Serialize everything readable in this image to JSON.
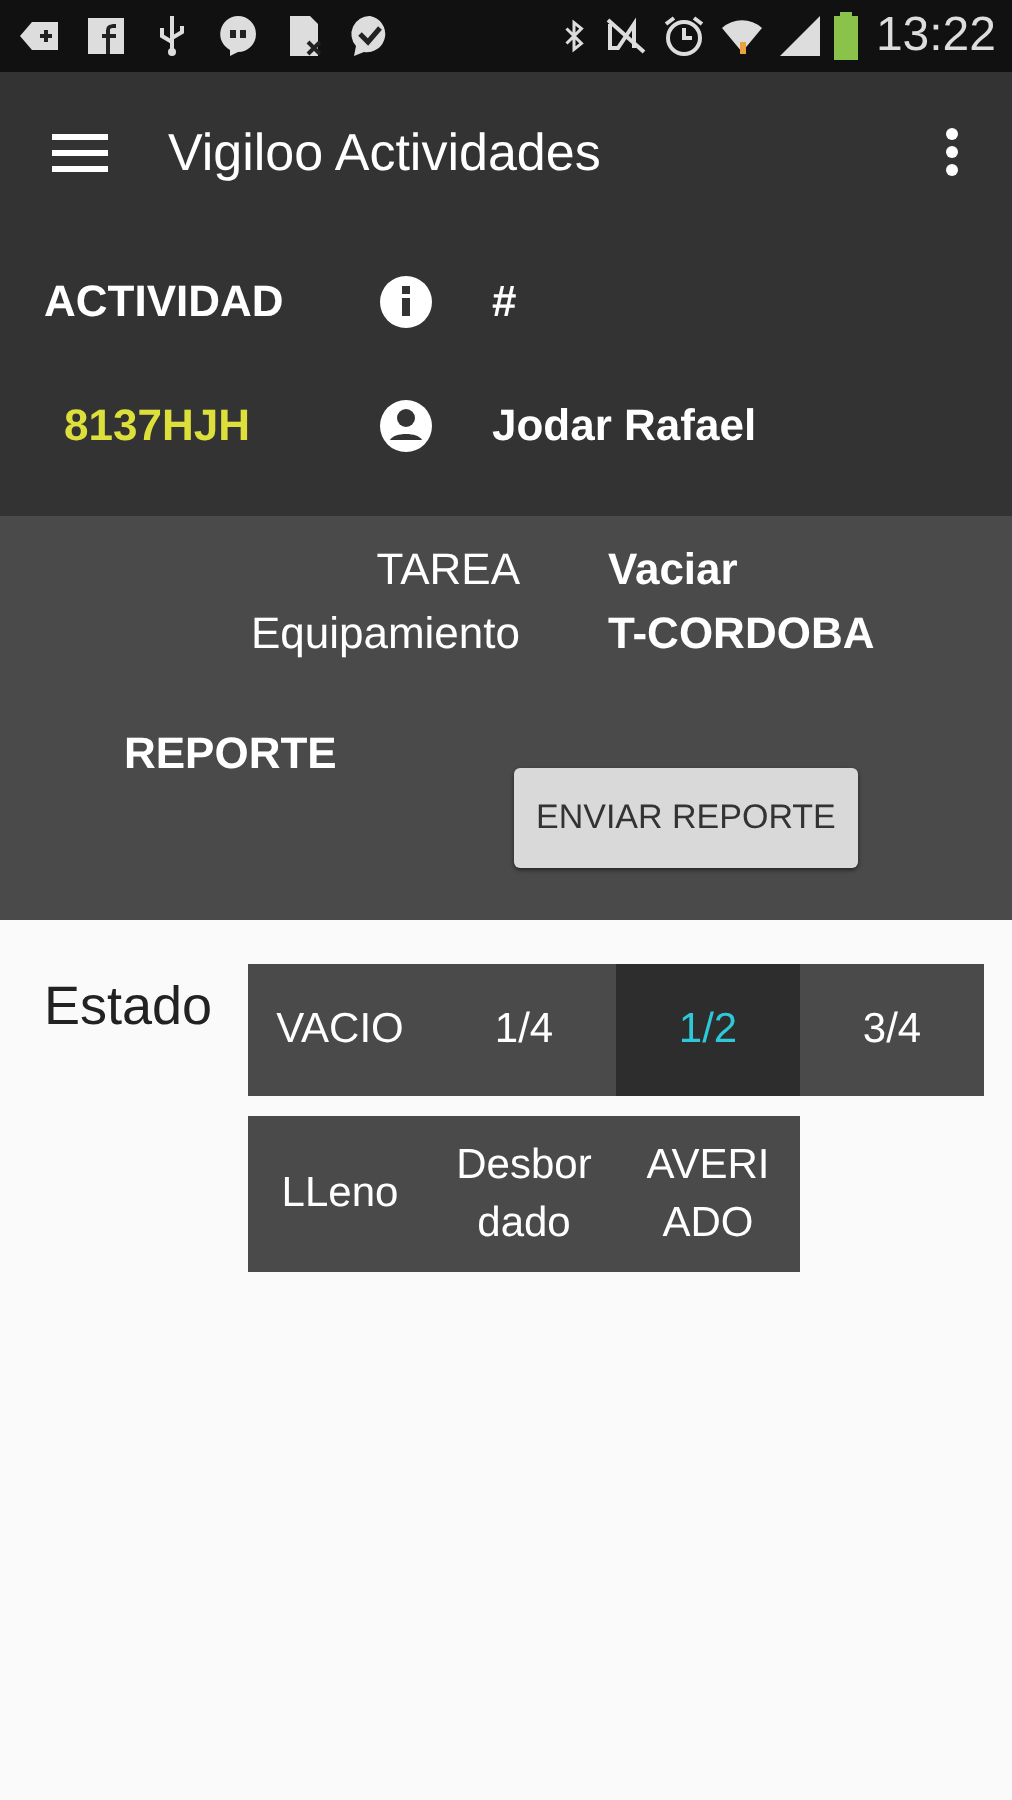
{
  "status_bar": {
    "time": "13:22"
  },
  "app_bar": {
    "title": "Vigiloo Actividades"
  },
  "activity": {
    "label": "ACTIVIDAD",
    "number_label": "#",
    "plate": "8137HJH",
    "person": "Jodar Rafael"
  },
  "task": {
    "task_label": "TAREA",
    "task_value": "Vaciar",
    "equipment_label": "Equipamiento",
    "equipment_value": "T-CORDOBA"
  },
  "report": {
    "label": "REPORTE",
    "button": "ENVIAR REPORTE"
  },
  "estado": {
    "label": "Estado",
    "options": [
      {
        "label": "VACIO",
        "selected": false
      },
      {
        "label": "1/4",
        "selected": false
      },
      {
        "label": "1/2",
        "selected": true
      },
      {
        "label": "3/4",
        "selected": false
      },
      {
        "label": "LLeno",
        "selected": false
      },
      {
        "label": "Desbordado",
        "selected": false
      },
      {
        "label": "AVERIADO",
        "selected": false
      }
    ]
  }
}
